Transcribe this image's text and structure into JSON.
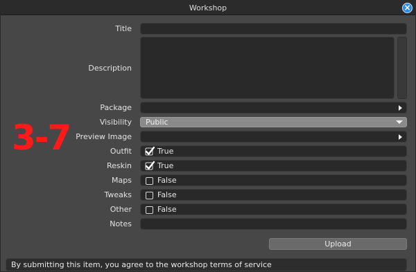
{
  "window": {
    "title": "Workshop"
  },
  "form": {
    "title": {
      "label": "Title",
      "value": ""
    },
    "description": {
      "label": "Description",
      "value": ""
    },
    "package": {
      "label": "Package",
      "value": ""
    },
    "visibility": {
      "label": "Visibility",
      "value": "Public"
    },
    "preview_image": {
      "label": "Preview Image",
      "value": ""
    },
    "outfit": {
      "label": "Outfit",
      "value": "True",
      "checked": true
    },
    "reskin": {
      "label": "Reskin",
      "value": "True",
      "checked": true
    },
    "maps": {
      "label": "Maps",
      "value": "False",
      "checked": false
    },
    "tweaks": {
      "label": "Tweaks",
      "value": "False",
      "checked": false
    },
    "other": {
      "label": "Other",
      "value": "False",
      "checked": false
    },
    "notes": {
      "label": "Notes",
      "value": ""
    }
  },
  "overlay": {
    "text": "3-7",
    "color": "#ff1a1a"
  },
  "actions": {
    "upload_label": "Upload"
  },
  "footer": {
    "terms_text": "By submitting this item, you agree to the workshop terms of service"
  },
  "icons": {
    "close": "close-icon",
    "checked": "checkmark-icon",
    "unchecked": "empty-checkbox-icon",
    "expand": "arrow-right-icon",
    "dropdown": "chevron-down-icon"
  }
}
